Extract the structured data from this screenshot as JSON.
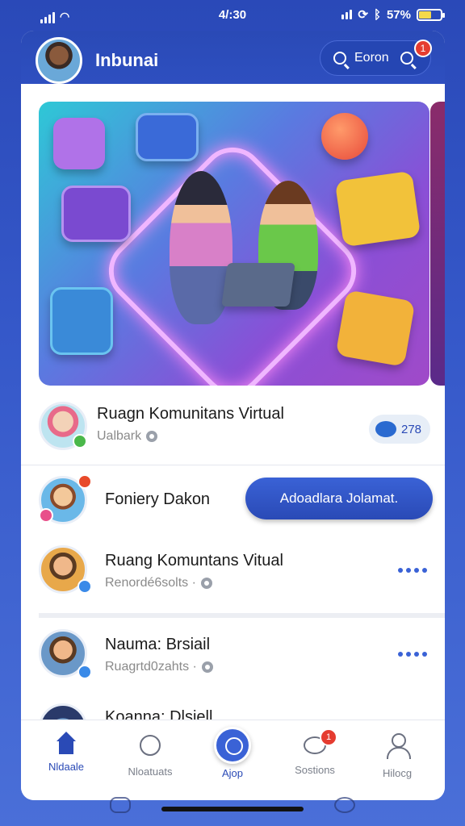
{
  "status_bar": {
    "time": "4/:30",
    "battery": "57%",
    "battery_level": 0.57
  },
  "header": {
    "title": "Inbunai",
    "search_label": "Eoron",
    "notification_count": "1"
  },
  "rows": [
    {
      "name": "Ruagn Komunitans Virtual",
      "sub": "Ualbark",
      "chip": "278"
    },
    {
      "name": "Foniery Dakon",
      "cta": "Adoadlara Jolamat."
    },
    {
      "name": "Ruang Komuntans Vitual",
      "sub": "Renordé6solts ·"
    },
    {
      "name": "Nauma: Brsiail",
      "sub": "Ruagrtd0zahts ·"
    },
    {
      "name": "Koanna: Dlsiell"
    }
  ],
  "tabs": [
    {
      "label": "Nldaale",
      "icon": "home-icon",
      "active": true
    },
    {
      "label": "Nloatuats",
      "icon": "search-icon",
      "active": false
    },
    {
      "label": "Ajop",
      "icon": "discover-icon",
      "active": false
    },
    {
      "label": "Sostions",
      "icon": "chat-icon",
      "active": false,
      "badge": "1"
    },
    {
      "label": "Hilocg",
      "icon": "profile-icon",
      "active": false
    }
  ],
  "colors": {
    "primary": "#2a4ab6",
    "accent": "#3a62d6",
    "badge": "#e53c30"
  }
}
